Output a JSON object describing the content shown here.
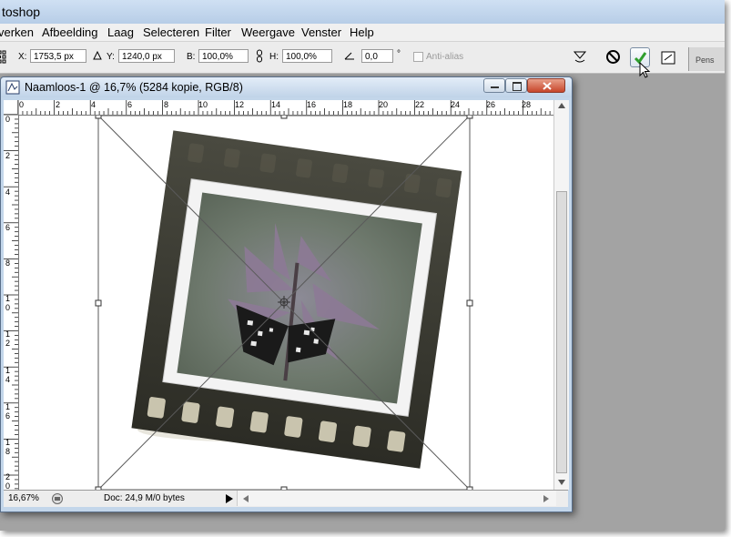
{
  "app": {
    "title": "toshop"
  },
  "menu": [
    "verken",
    "Afbeelding",
    "Laag",
    "Selecteren",
    "Filter",
    "Weergave",
    "Venster",
    "Help"
  ],
  "options": {
    "x_label": "X:",
    "x_value": "1753,5 px",
    "delta_icon": "delta-icon",
    "y_label": "Y:",
    "y_value": "1240,0 px",
    "b_label": "B:",
    "b_value": "100,0%",
    "h_label": "H:",
    "h_value": "100,0%",
    "angle_value": "0,0",
    "degree": "°",
    "antialias_label": "Anti-alias",
    "panel_tab": "Pens"
  },
  "document": {
    "title": "Naamloos-1 @ 16,7% (5284 kopie, RGB/8)",
    "zoom": "16,67%",
    "doc_info": "Doc: 24,9 M/0 bytes"
  },
  "rulers": {
    "h_labels": [
      "0",
      "2",
      "4",
      "6",
      "8",
      "10",
      "12",
      "14",
      "16",
      "18",
      "20",
      "22",
      "24",
      "26",
      "28"
    ],
    "v_labels": [
      "0",
      "2",
      "4",
      "6",
      "8",
      "1 0",
      "1 2",
      "1 4",
      "1 6",
      "1 8",
      "2 0"
    ]
  },
  "colors": {
    "commit_green": "#2e9e2e",
    "window_chrome": "#c3d6ea"
  }
}
